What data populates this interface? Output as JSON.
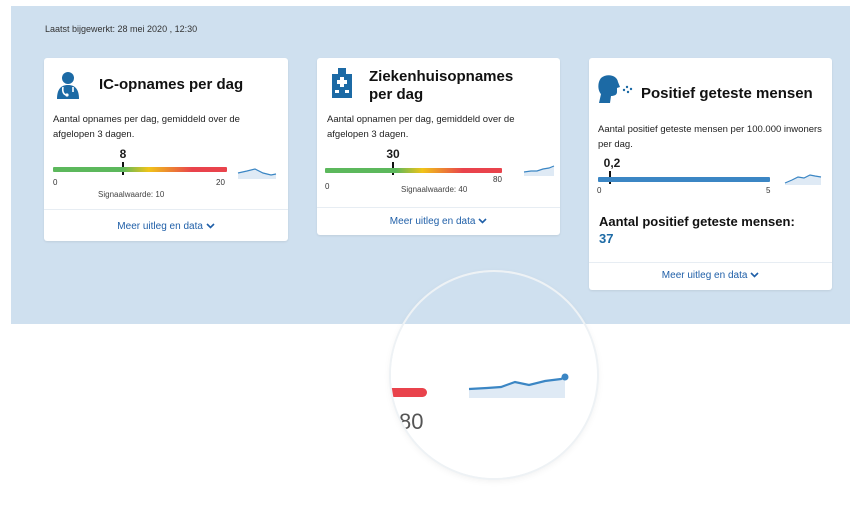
{
  "last_updated": "Laatst bijgewerkt: 28 mei 2020 , 12:30",
  "colors": {
    "panel": "#cfe0ef",
    "accent_blue": "#1c6aa5",
    "green": "#5cb85c",
    "yellow": "#f0c419",
    "red": "#e9434c",
    "link": "#1f5fa8"
  },
  "cards": {
    "ic": {
      "icon": "doctor-icon",
      "title": "IC-opnames per dag",
      "description": "Aantal opnames per dag, gemiddeld over de afgelopen 3 dagen.",
      "value": "8",
      "scale_min": "0",
      "scale_max": "20",
      "signal": "Signaalwaarde: 10",
      "more": "Meer uitleg en data"
    },
    "hospital": {
      "icon": "hospital-icon",
      "title": "Ziekenhuisopnames per dag",
      "description": "Aantal opnamen per dag, gemiddeld over de afgelopen 3 dagen.",
      "value": "30",
      "scale_min": "0",
      "scale_max": "80",
      "signal": "Signaalwaarde: 40",
      "more": "Meer uitleg en data"
    },
    "positive": {
      "icon": "coughing-person-icon",
      "title": "Positief geteste mensen",
      "description": "Aantal positief geteste mensen per 100.000 inwoners per dag.",
      "value": "0,2",
      "scale_min": "0",
      "scale_max": "5",
      "count_label": "Aantal positief geteste mensen:",
      "count_value": "37",
      "more": "Meer uitleg en data"
    }
  },
  "magnifier": {
    "scale_max": "80"
  }
}
